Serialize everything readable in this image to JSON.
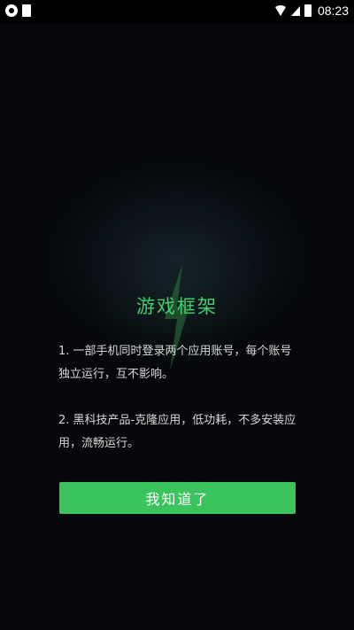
{
  "status_bar": {
    "time": "08:23",
    "icons": [
      "notification-icon",
      "app-icon",
      "wifi-icon",
      "signal-icon",
      "battery-icon"
    ]
  },
  "dialog": {
    "title": "游戏框架",
    "paragraphs": [
      "1. 一部手机同时登录两个应用账号，每个账号独立运行，互不影响。",
      "2. 黑科技产品-克隆应用，低功耗，不多安装应用，流畅运行。"
    ],
    "confirm_label": "我知道了"
  },
  "colors": {
    "accent": "#3bc45e",
    "title": "#3fd16b",
    "background": "#05070a"
  }
}
